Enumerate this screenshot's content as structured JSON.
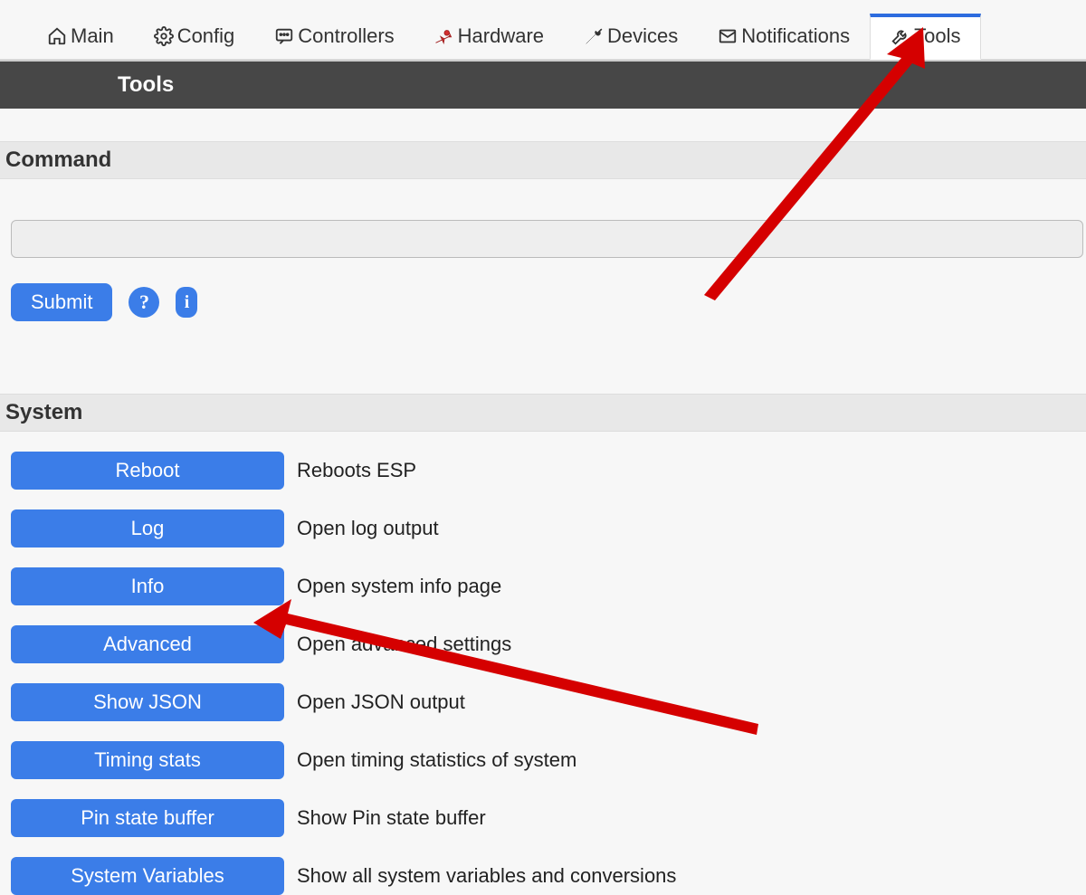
{
  "nav": {
    "tabs": [
      {
        "label": "Main",
        "icon": "home"
      },
      {
        "label": "Config",
        "icon": "gear"
      },
      {
        "label": "Controllers",
        "icon": "speech"
      },
      {
        "label": "Hardware",
        "icon": "pin"
      },
      {
        "label": "Devices",
        "icon": "wrench-dark"
      },
      {
        "label": "Notifications",
        "icon": "mail"
      },
      {
        "label": "Tools",
        "icon": "wrench"
      }
    ],
    "active_index": 6
  },
  "page_title": "Tools",
  "sections": {
    "command": {
      "header": "Command",
      "submit_label": "Submit",
      "help_glyph": "?",
      "info_glyph": "i",
      "input_value": ""
    },
    "system": {
      "header": "System",
      "items": [
        {
          "label": "Reboot",
          "desc": "Reboots ESP"
        },
        {
          "label": "Log",
          "desc": "Open log output"
        },
        {
          "label": "Info",
          "desc": "Open system info page"
        },
        {
          "label": "Advanced",
          "desc": "Open advanced settings"
        },
        {
          "label": "Show JSON",
          "desc": "Open JSON output"
        },
        {
          "label": "Timing stats",
          "desc": "Open timing statistics of system"
        },
        {
          "label": "Pin state buffer",
          "desc": "Show Pin state buffer"
        },
        {
          "label": "System Variables",
          "desc": "Show all system variables and conversions"
        }
      ]
    }
  }
}
